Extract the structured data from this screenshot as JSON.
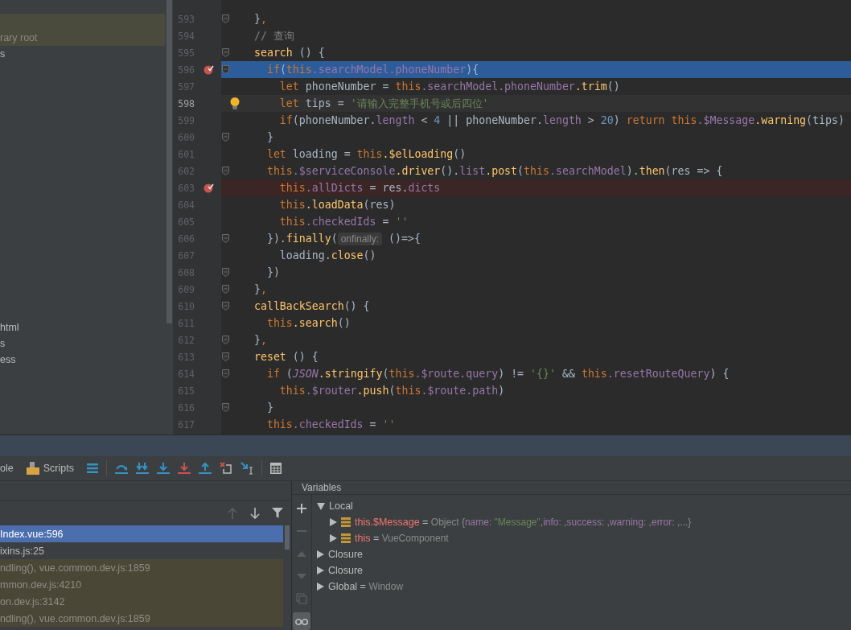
{
  "project_panel": {
    "items": [
      {
        "label": "rary root",
        "highlighted": true
      },
      {
        "label": "s",
        "highlighted": false
      },
      {
        "label": "html",
        "highlighted": false
      },
      {
        "label": "s",
        "highlighted": false
      },
      {
        "label": "ess",
        "highlighted": false
      }
    ]
  },
  "editor": {
    "lines": [
      {
        "number": "593",
        "fold": true,
        "breakpoint": false,
        "execution": false,
        "caret": false,
        "bulb": false,
        "tokens": [
          {
            "kind": "plain",
            "text": "  }"
          },
          {
            "kind": "kw",
            "text": ","
          }
        ]
      },
      {
        "number": "594",
        "fold": false,
        "breakpoint": false,
        "execution": false,
        "caret": false,
        "bulb": false,
        "tokens": [
          {
            "kind": "comment",
            "text": "  // 查询"
          }
        ]
      },
      {
        "number": "595",
        "fold": true,
        "breakpoint": false,
        "execution": false,
        "caret": false,
        "bulb": false,
        "tokens": [
          {
            "kind": "func",
            "text": "  search"
          },
          {
            "kind": "plain",
            "text": " () {"
          }
        ]
      },
      {
        "number": "596",
        "fold": true,
        "breakpoint": true,
        "execution": true,
        "caret": false,
        "bulb": false,
        "tokens": [
          {
            "kind": "kw",
            "text": "    if"
          },
          {
            "kind": "plain",
            "text": "("
          },
          {
            "kind": "kw",
            "text": "this"
          },
          {
            "kind": "field",
            "text": ".searchModel"
          },
          {
            "kind": "field",
            "text": ".phoneNumber"
          },
          {
            "kind": "plain",
            "text": "){"
          }
        ]
      },
      {
        "number": "597",
        "fold": false,
        "breakpoint": false,
        "execution": false,
        "caret": false,
        "bulb": false,
        "tokens": [
          {
            "kind": "kw",
            "text": "      let"
          },
          {
            "kind": "plain",
            "text": " phoneNumber = "
          },
          {
            "kind": "kw",
            "text": "this"
          },
          {
            "kind": "field",
            "text": ".searchModel"
          },
          {
            "kind": "field",
            "text": ".phoneNumber"
          },
          {
            "kind": "func",
            "text": ".trim"
          },
          {
            "kind": "plain",
            "text": "()"
          }
        ]
      },
      {
        "number": "598",
        "fold": false,
        "breakpoint": false,
        "execution": false,
        "caret": true,
        "bulb": true,
        "tokens": [
          {
            "kind": "kw",
            "text": "      let"
          },
          {
            "kind": "plain",
            "text": " tips = "
          },
          {
            "kind": "string",
            "text": "'请输入完整手机号或后四位'"
          }
        ]
      },
      {
        "number": "599",
        "fold": false,
        "breakpoint": false,
        "execution": false,
        "caret": false,
        "bulb": false,
        "tokens": [
          {
            "kind": "kw",
            "text": "      if"
          },
          {
            "kind": "plain",
            "text": "(phoneNumber."
          },
          {
            "kind": "field",
            "text": "length"
          },
          {
            "kind": "plain",
            "text": " < "
          },
          {
            "kind": "num",
            "text": "4"
          },
          {
            "kind": "plain",
            "text": " || phoneNumber."
          },
          {
            "kind": "field",
            "text": "length"
          },
          {
            "kind": "plain",
            "text": " > "
          },
          {
            "kind": "num",
            "text": "20"
          },
          {
            "kind": "plain",
            "text": ") "
          },
          {
            "kind": "kw",
            "text": "return this"
          },
          {
            "kind": "field",
            "text": ".$Message"
          },
          {
            "kind": "func",
            "text": ".warning"
          },
          {
            "kind": "plain",
            "text": "(tips)"
          }
        ]
      },
      {
        "number": "600",
        "fold": true,
        "breakpoint": false,
        "execution": false,
        "caret": false,
        "bulb": false,
        "tokens": [
          {
            "kind": "plain",
            "text": "    }"
          }
        ]
      },
      {
        "number": "601",
        "fold": false,
        "breakpoint": false,
        "execution": false,
        "caret": false,
        "bulb": false,
        "tokens": [
          {
            "kind": "kw",
            "text": "    let"
          },
          {
            "kind": "plain",
            "text": " loading = "
          },
          {
            "kind": "kw",
            "text": "this"
          },
          {
            "kind": "func",
            "text": ".$elLoading"
          },
          {
            "kind": "plain",
            "text": "()"
          }
        ]
      },
      {
        "number": "602",
        "fold": true,
        "breakpoint": false,
        "execution": false,
        "caret": false,
        "bulb": false,
        "tokens": [
          {
            "kind": "kw",
            "text": "    this"
          },
          {
            "kind": "field",
            "text": ".$serviceConsole"
          },
          {
            "kind": "func",
            "text": ".driver"
          },
          {
            "kind": "plain",
            "text": "()."
          },
          {
            "kind": "field",
            "text": "list"
          },
          {
            "kind": "func",
            "text": ".post"
          },
          {
            "kind": "plain",
            "text": "("
          },
          {
            "kind": "kw",
            "text": "this"
          },
          {
            "kind": "field",
            "text": ".searchModel"
          },
          {
            "kind": "plain",
            "text": ")."
          },
          {
            "kind": "func",
            "text": "then"
          },
          {
            "kind": "plain",
            "text": "(res => {"
          }
        ]
      },
      {
        "number": "603",
        "fold": false,
        "breakpoint": true,
        "execution": false,
        "caret": false,
        "bulb": false,
        "tokens": [
          {
            "kind": "kw",
            "text": "      this"
          },
          {
            "kind": "field",
            "text": ".allDicts"
          },
          {
            "kind": "plain",
            "text": " = res."
          },
          {
            "kind": "field",
            "text": "dicts"
          }
        ]
      },
      {
        "number": "604",
        "fold": false,
        "breakpoint": false,
        "execution": false,
        "caret": false,
        "bulb": false,
        "tokens": [
          {
            "kind": "kw",
            "text": "      this"
          },
          {
            "kind": "func",
            "text": ".loadData"
          },
          {
            "kind": "plain",
            "text": "(res)"
          }
        ]
      },
      {
        "number": "605",
        "fold": false,
        "breakpoint": false,
        "execution": false,
        "caret": false,
        "bulb": false,
        "tokens": [
          {
            "kind": "kw",
            "text": "      this"
          },
          {
            "kind": "field",
            "text": ".checkedIds"
          },
          {
            "kind": "plain",
            "text": " = "
          },
          {
            "kind": "string",
            "text": "''"
          }
        ]
      },
      {
        "number": "606",
        "fold": true,
        "breakpoint": false,
        "execution": false,
        "caret": false,
        "bulb": false,
        "tokens": [
          {
            "kind": "plain",
            "text": "    })."
          },
          {
            "kind": "func",
            "text": "finally"
          },
          {
            "kind": "plain",
            "text": "("
          },
          {
            "kind": "hint",
            "text": "onfinally:"
          },
          {
            "kind": "plain",
            "text": " ()=>{"
          }
        ]
      },
      {
        "number": "607",
        "fold": false,
        "breakpoint": false,
        "execution": false,
        "caret": false,
        "bulb": false,
        "tokens": [
          {
            "kind": "plain",
            "text": "      loading."
          },
          {
            "kind": "func",
            "text": "close"
          },
          {
            "kind": "plain",
            "text": "()"
          }
        ]
      },
      {
        "number": "608",
        "fold": true,
        "breakpoint": false,
        "execution": false,
        "caret": false,
        "bulb": false,
        "tokens": [
          {
            "kind": "plain",
            "text": "    })"
          }
        ]
      },
      {
        "number": "609",
        "fold": true,
        "breakpoint": false,
        "execution": false,
        "caret": false,
        "bulb": false,
        "tokens": [
          {
            "kind": "plain",
            "text": "  }"
          },
          {
            "kind": "kw",
            "text": ","
          }
        ]
      },
      {
        "number": "610",
        "fold": true,
        "breakpoint": false,
        "execution": false,
        "caret": false,
        "bulb": false,
        "tokens": [
          {
            "kind": "func",
            "text": "  callBackSearch"
          },
          {
            "kind": "plain",
            "text": "() {"
          }
        ]
      },
      {
        "number": "611",
        "fold": false,
        "breakpoint": false,
        "execution": false,
        "caret": false,
        "bulb": false,
        "tokens": [
          {
            "kind": "kw",
            "text": "    this"
          },
          {
            "kind": "func",
            "text": ".search"
          },
          {
            "kind": "plain",
            "text": "()"
          }
        ]
      },
      {
        "number": "612",
        "fold": true,
        "breakpoint": false,
        "execution": false,
        "caret": false,
        "bulb": false,
        "tokens": [
          {
            "kind": "plain",
            "text": "  }"
          },
          {
            "kind": "kw",
            "text": ","
          }
        ]
      },
      {
        "number": "613",
        "fold": true,
        "breakpoint": false,
        "execution": false,
        "caret": false,
        "bulb": false,
        "tokens": [
          {
            "kind": "func",
            "text": "  reset"
          },
          {
            "kind": "plain",
            "text": " () {"
          }
        ]
      },
      {
        "number": "614",
        "fold": true,
        "breakpoint": false,
        "execution": false,
        "caret": false,
        "bulb": false,
        "tokens": [
          {
            "kind": "kw",
            "text": "    if"
          },
          {
            "kind": "plain",
            "text": " ("
          },
          {
            "kind": "static",
            "text": "JSON"
          },
          {
            "kind": "func",
            "text": ".stringify"
          },
          {
            "kind": "plain",
            "text": "("
          },
          {
            "kind": "kw",
            "text": "this"
          },
          {
            "kind": "field",
            "text": ".$route"
          },
          {
            "kind": "field",
            "text": ".query"
          },
          {
            "kind": "plain",
            "text": ") != "
          },
          {
            "kind": "string",
            "text": "'{}'"
          },
          {
            "kind": "plain",
            "text": " && "
          },
          {
            "kind": "kw",
            "text": "this"
          },
          {
            "kind": "field",
            "text": ".resetRouteQuery"
          },
          {
            "kind": "plain",
            "text": ") {"
          }
        ]
      },
      {
        "number": "615",
        "fold": false,
        "breakpoint": false,
        "execution": false,
        "caret": false,
        "bulb": false,
        "tokens": [
          {
            "kind": "kw",
            "text": "      this"
          },
          {
            "kind": "field",
            "text": ".$router"
          },
          {
            "kind": "func",
            "text": ".push"
          },
          {
            "kind": "plain",
            "text": "("
          },
          {
            "kind": "kw",
            "text": "this"
          },
          {
            "kind": "field",
            "text": ".$route"
          },
          {
            "kind": "field",
            "text": ".path"
          },
          {
            "kind": "plain",
            "text": ")"
          }
        ]
      },
      {
        "number": "616",
        "fold": true,
        "breakpoint": false,
        "execution": false,
        "caret": false,
        "bulb": false,
        "tokens": [
          {
            "kind": "plain",
            "text": "    }"
          }
        ]
      },
      {
        "number": "617",
        "fold": false,
        "breakpoint": false,
        "execution": false,
        "caret": false,
        "bulb": false,
        "tokens": [
          {
            "kind": "kw",
            "text": "    this"
          },
          {
            "kind": "field",
            "text": ".checkedIds"
          },
          {
            "kind": "plain",
            "text": " = "
          },
          {
            "kind": "string",
            "text": "''"
          }
        ]
      }
    ]
  },
  "debug_toolbar": {
    "tabs": [
      {
        "label": "ole",
        "kind": "console"
      },
      {
        "label": "Scripts",
        "kind": "scripts"
      }
    ]
  },
  "frames": {
    "tools": [
      {
        "kind": "up",
        "disabled": true
      },
      {
        "kind": "down",
        "disabled": false
      },
      {
        "kind": "filter",
        "disabled": false
      }
    ],
    "items": [
      {
        "label": "Index.vue:596",
        "selected": true,
        "library": false
      },
      {
        "label": "ixins.js:25",
        "selected": false,
        "library": false
      },
      {
        "label": "ndling(), vue.common.dev.js:1859",
        "selected": false,
        "library": true
      },
      {
        "label": "mmon.dev.js:4210",
        "selected": false,
        "library": true
      },
      {
        "label": "on.dev.js:3142",
        "selected": false,
        "library": true
      },
      {
        "label": "ndling(), vue.common.dev.js:1859",
        "selected": false,
        "library": true
      }
    ]
  },
  "variables": {
    "title": "Variables",
    "tools": [
      {
        "kind": "add",
        "disabled": false,
        "on": false
      },
      {
        "kind": "remove",
        "disabled": true,
        "on": false
      },
      {
        "kind": "up",
        "disabled": true,
        "on": false
      },
      {
        "kind": "down",
        "disabled": true,
        "on": false
      },
      {
        "kind": "copy",
        "disabled": true,
        "on": false
      },
      {
        "kind": "watches",
        "disabled": false,
        "on": true
      }
    ],
    "tree": [
      {
        "name": "Local",
        "expanded": true,
        "children": [
          {
            "name": "this.$Message",
            "kind": "field",
            "expanded": false,
            "value": [
              {
                "kind": "op",
                "text": " = "
              },
              {
                "kind": "dim",
                "text": "Object {"
              },
              {
                "kind": "key",
                "text": "name"
              },
              {
                "kind": "dim",
                "text": ": "
              },
              {
                "kind": "string",
                "text": "\"Message\""
              },
              {
                "kind": "dim",
                "text": ","
              },
              {
                "kind": "key",
                "text": "info"
              },
              {
                "kind": "dim",
                "text": ": ,"
              },
              {
                "kind": "key",
                "text": "success"
              },
              {
                "kind": "dim",
                "text": ": ,"
              },
              {
                "kind": "key",
                "text": "warning"
              },
              {
                "kind": "dim",
                "text": ": ,"
              },
              {
                "kind": "key",
                "text": "error"
              },
              {
                "kind": "dim",
                "text": ": ,...}"
              }
            ]
          },
          {
            "name": "this",
            "kind": "field",
            "expanded": false,
            "value": [
              {
                "kind": "op",
                "text": " = "
              },
              {
                "kind": "dim",
                "text": "VueComponent"
              }
            ]
          }
        ]
      },
      {
        "name": "Closure",
        "expanded": false
      },
      {
        "name": "Closure",
        "expanded": false
      },
      {
        "name": "Global",
        "expanded": false,
        "value": [
          {
            "kind": "op",
            "text": " = "
          },
          {
            "kind": "dim",
            "text": "Window"
          }
        ]
      }
    ]
  }
}
